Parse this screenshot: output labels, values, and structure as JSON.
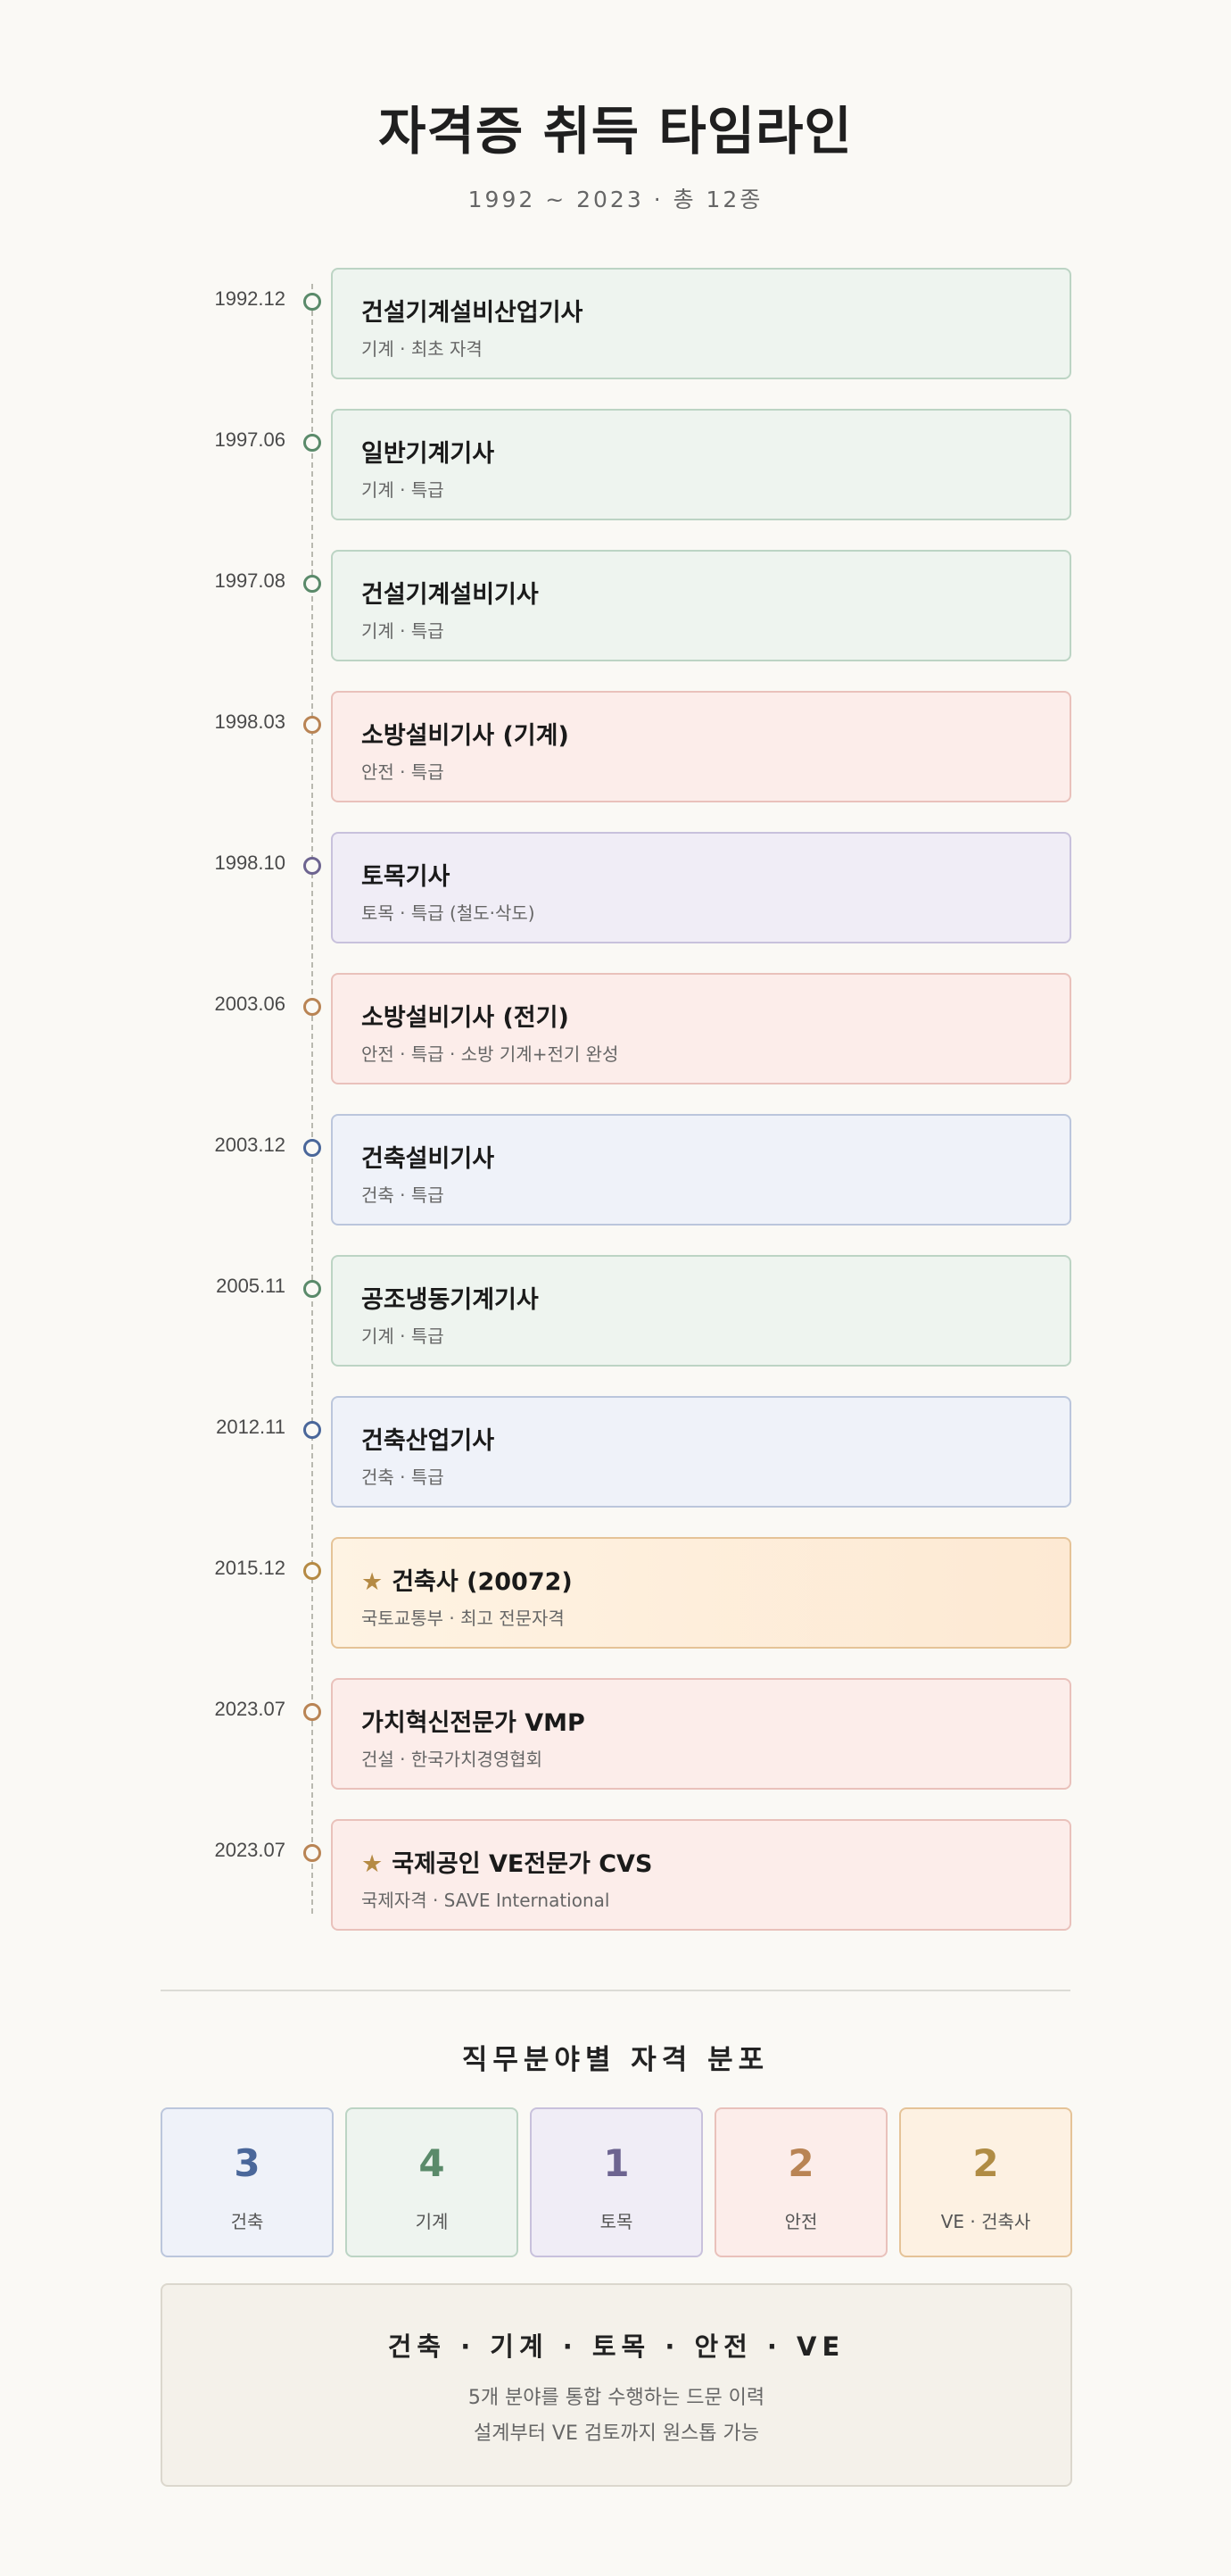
{
  "header": {
    "title": "자격증 취득 타임라인",
    "subtitle": "1992 ~ 2023 · 총 12종"
  },
  "timeline": [
    {
      "date": "1992.12",
      "title": "건설기계설비산업기사",
      "sub": "기계 · 최초 자격",
      "category": "기계",
      "star": false
    },
    {
      "date": "1997.06",
      "title": "일반기계기사",
      "sub": "기계 · 특급",
      "category": "기계",
      "star": false
    },
    {
      "date": "1997.08",
      "title": "건설기계설비기사",
      "sub": "기계 · 특급",
      "category": "기계",
      "star": false
    },
    {
      "date": "1998.03",
      "title": "소방설비기사 (기계)",
      "sub": "안전 · 특급",
      "category": "안전",
      "star": false
    },
    {
      "date": "1998.10",
      "title": "토목기사",
      "sub": "토목 · 특급 (철도·삭도)",
      "category": "토목",
      "star": false
    },
    {
      "date": "2003.06",
      "title": "소방설비기사 (전기)",
      "sub": "안전 · 특급 · 소방 기계+전기 완성",
      "category": "안전",
      "star": false
    },
    {
      "date": "2003.12",
      "title": "건축설비기사",
      "sub": "건축 · 특급",
      "category": "건축",
      "star": false
    },
    {
      "date": "2005.11",
      "title": "공조냉동기계기사",
      "sub": "기계 · 특급",
      "category": "기계",
      "star": false
    },
    {
      "date": "2012.11",
      "title": "건축산업기사",
      "sub": "건축 · 특급",
      "category": "건축",
      "star": false
    },
    {
      "date": "2015.12",
      "title": "건축사 (20072)",
      "sub": "국토교통부 · 최고 전문자격",
      "category": "건축사",
      "star": true
    },
    {
      "date": "2023.07",
      "title": "가치혁신전문가 VMP",
      "sub": "건설 · 한국가치경영협회",
      "category": "VE",
      "star": false
    },
    {
      "date": "2023.07",
      "title": "국제공인 VE전문가 CVS",
      "sub": "국제자격 · SAVE International",
      "category": "VE",
      "star": true
    }
  ],
  "star_icon": "★",
  "categories": {
    "기계": {
      "dot": "#5a8a6a",
      "border": "#bcd4c4",
      "bg": "#eef4ef"
    },
    "안전": {
      "dot": "#b98454",
      "border": "#e9c1bb",
      "bg": "#fcedea"
    },
    "토목": {
      "dot": "#6d6490",
      "border": "#c8c1dc",
      "bg": "#f0edf6"
    },
    "건축": {
      "dot": "#4a679a",
      "border": "#bbc6dc",
      "bg": "#eff2f9"
    },
    "건축사": {
      "dot": "#b58a44",
      "border": "#e5c397",
      "bg": "#fdeedb"
    },
    "VE": {
      "dot": "#b98454",
      "border": "#e9c1bb",
      "bg": "#fcedea"
    }
  },
  "distribution": {
    "title": "직무분야별 자격 분포",
    "items": [
      {
        "count": "3",
        "label": "건축",
        "color": "#4a679a",
        "border": "#bbc6dc",
        "bg": "#eff2f9"
      },
      {
        "count": "4",
        "label": "기계",
        "color": "#5a8a6a",
        "border": "#bcd4c4",
        "bg": "#eef4ef"
      },
      {
        "count": "1",
        "label": "토목",
        "color": "#6d6490",
        "border": "#c8c1dc",
        "bg": "#f0edf6"
      },
      {
        "count": "2",
        "label": "안전",
        "color": "#b98454",
        "border": "#e9c1bb",
        "bg": "#fcedea"
      },
      {
        "count": "2",
        "label": "VE · 건축사",
        "color": "#b08c44",
        "border": "#e5c397",
        "bg": "#fdf1e2"
      }
    ]
  },
  "summary": {
    "title": "건축 · 기계 · 토목 · 안전 · VE",
    "line1": "5개 분야를 통합 수행하는 드문 이력",
    "line2": "설계부터 VE 검토까지 원스톱 가능"
  }
}
